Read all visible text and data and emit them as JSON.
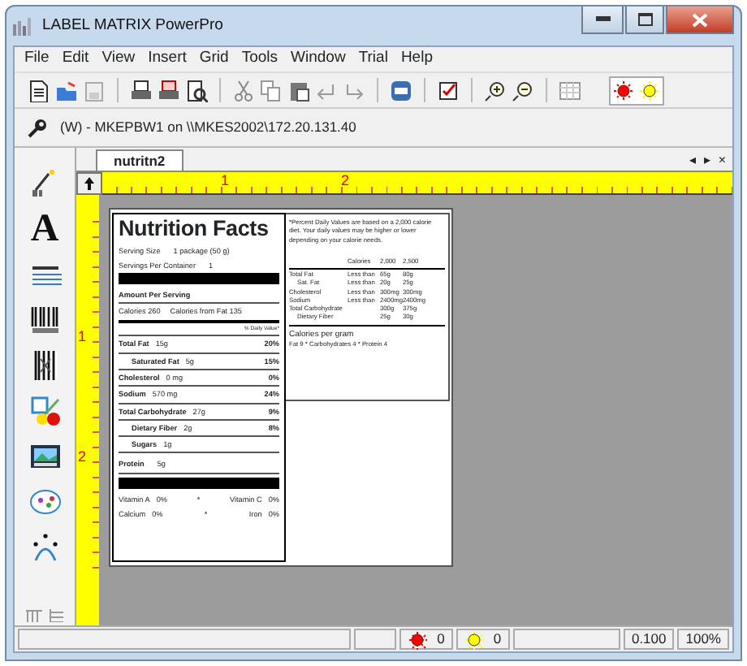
{
  "window": {
    "title": "LABEL MATRIX PowerPro"
  },
  "menu": [
    "File",
    "Edit",
    "View",
    "Insert",
    "Grid",
    "Tools",
    "Window",
    "Trial",
    "Help"
  ],
  "connection": "(W) - MKEPBW1 on \\\\MKES2002\\172.20.131.40",
  "document_tab": {
    "label": "nutritn2",
    "selected": true
  },
  "tab_controls": [
    "◂",
    "▸",
    "×"
  ],
  "palette": {
    "text_tool_glyph": "A"
  },
  "ruler": {
    "horizontal": [
      "1",
      "2"
    ],
    "vertical": [
      "1",
      "2"
    ]
  },
  "label": {
    "title": "Nutrition Facts",
    "serving_size": {
      "label": "Serving Size",
      "value": "1 package (50 g)"
    },
    "servings": {
      "label": "Servings Per Container",
      "value": "1"
    },
    "amount_heading": "Amount Per Serving",
    "calories": "Calories 260",
    "calories_from_fat": "Calories from Fat 135",
    "daily_value_heading": "% Daily Value*",
    "nutrients": [
      {
        "name": "Total Fat",
        "amount": "15g",
        "dv": "20%",
        "children": [
          {
            "name": "Saturated Fat",
            "amount": "5g",
            "dv": "15%"
          }
        ]
      },
      {
        "name": "Cholesterol",
        "amount": "0 mg",
        "dv": "0%"
      },
      {
        "name": "Sodium",
        "amount": "570 mg",
        "dv": "24%"
      },
      {
        "name": "Total Carbohydrate",
        "amount": "27g",
        "dv": "9%",
        "children": [
          {
            "name": "Dietary Fiber",
            "amount": "2g",
            "dv": "8%"
          },
          {
            "name": "Sugars",
            "amount": "1g"
          }
        ]
      }
    ],
    "protein": {
      "name": "Protein",
      "amount": "5g"
    },
    "vitamins": [
      {
        "left": {
          "name": "Vitamin A",
          "value": "0%"
        },
        "sep": "*",
        "right": {
          "name": "Vitamin C",
          "value": "0%"
        }
      },
      {
        "left": {
          "name": "Calcium",
          "value": "0%"
        },
        "sep": "*",
        "right": {
          "name": "Iron",
          "value": "0%"
        }
      }
    ],
    "footnote": "*Percent Daily Values are based on a 2,000 calorie diet. Your daily values may be higher or lower depending on your calorie needs.",
    "reference_header": [
      "Calories",
      "2,000",
      "2,500"
    ],
    "reference_rows": [
      {
        "name": "Total Fat",
        "limit": "Less than",
        "a": "65g",
        "b": "80g",
        "indented": false
      },
      {
        "name": "Sat. Fat",
        "limit": "Less than",
        "a": "20g",
        "b": "25g",
        "indented": true
      },
      {
        "name": "Cholesterol",
        "limit": "Less than",
        "a": "300mg",
        "b": "300mg",
        "indented": false
      },
      {
        "name": "Sodium",
        "limit": "Less than",
        "a": "2400mg",
        "b": "2400mg",
        "indented": false
      },
      {
        "name": "Total Carbohydrate",
        "a": "300g",
        "b": "375g",
        "indented": false
      },
      {
        "name": "Dietary Fiber",
        "a": "25g",
        "b": "30g",
        "indented": true
      }
    ],
    "calories_per_gram": "Calories per gram",
    "per_gram_values": "Fat 9  *  Carbohydrates 4  *  Protein 4"
  },
  "status_bar": {
    "errors": "0",
    "warnings": "0",
    "scale": "0.100",
    "zoom": "100%"
  }
}
